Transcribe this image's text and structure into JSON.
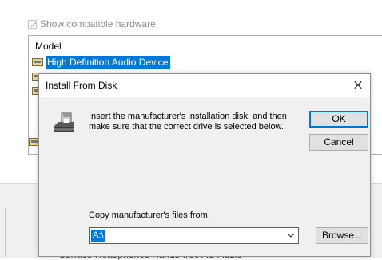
{
  "background": {
    "compat_checkbox_label": "Show compatible hardware",
    "compat_checked": true,
    "model_header": "Model",
    "selected_model": "High Definition Audio Device",
    "bottom_partial_text": "Surface Headphones Hands-free AG Audio"
  },
  "dialog": {
    "title": "Install From Disk",
    "message": "Insert the manufacturer's installation disk, and then make sure that the correct drive is selected below.",
    "ok_label": "OK",
    "cancel_label": "Cancel",
    "copy_label": "Copy manufacturer's files from:",
    "path_value": "A:\\",
    "browse_label": "Browse...",
    "icons": {
      "close": "close-icon",
      "disk": "floppy-drive-icon",
      "dropdown": "chevron-down-icon"
    }
  },
  "colors": {
    "selection": "#0078d7",
    "dialog_bg": "#f0f0f0",
    "button_bg": "#e1e1e1"
  }
}
